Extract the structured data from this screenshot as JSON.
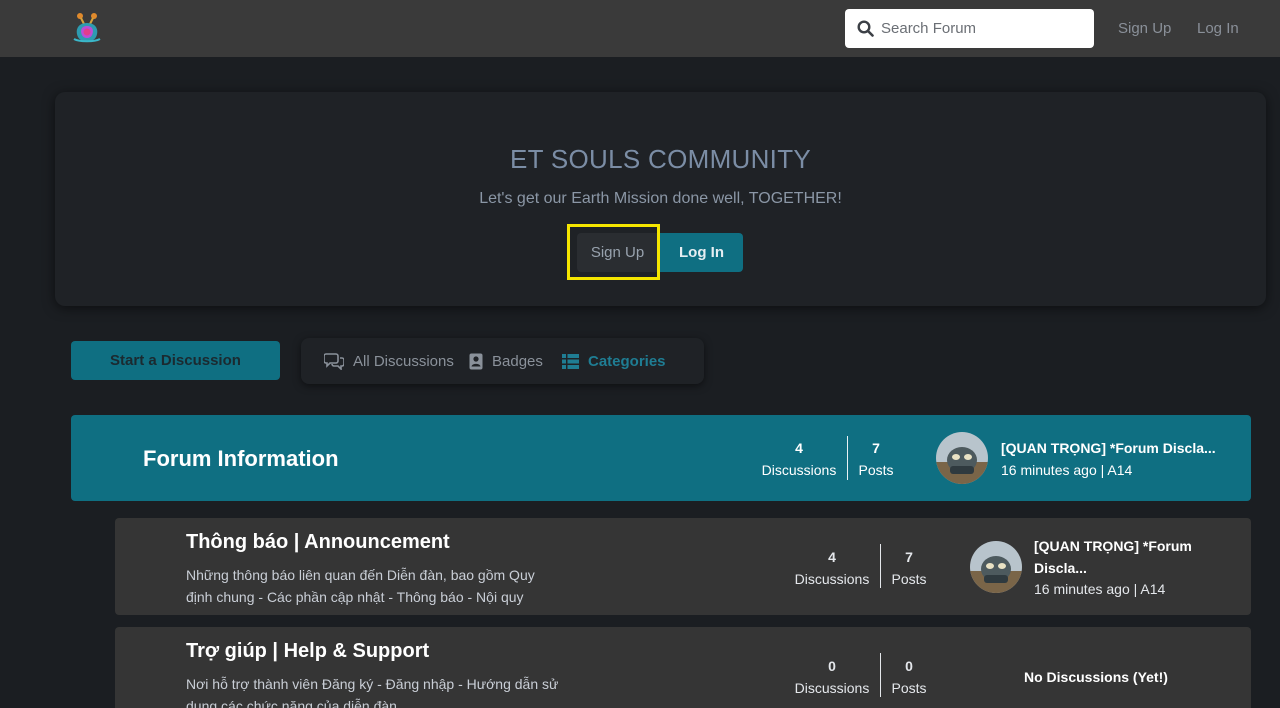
{
  "header": {
    "search_placeholder": "Search Forum",
    "signup": "Sign Up",
    "login": "Log In"
  },
  "hero": {
    "title": "ET SOULS COMMUNITY",
    "subtitle": "Let's get our Earth Mission done well, TOGETHER!",
    "signup": "Sign Up",
    "login": "Log In"
  },
  "toolbar": {
    "start": "Start a Discussion",
    "nav": [
      {
        "label": "All Discussions",
        "icon": "chat-bubbles-icon"
      },
      {
        "label": "Badges",
        "icon": "badge-icon"
      },
      {
        "label": "Categories",
        "icon": "grid-list-icon",
        "active": true
      }
    ]
  },
  "categories": {
    "main": {
      "title": "Forum Information",
      "discussions": "4",
      "discussions_label": "Discussions",
      "posts": "7",
      "posts_label": "Posts",
      "last_title": "[QUAN TRỌNG] *Forum Discla...",
      "last_meta": "16 minutes ago | A14"
    },
    "subs": [
      {
        "title": "Thông báo | Announcement",
        "desc": "Những thông báo liên quan đến Diễn đàn, bao gồm Quy định chung - Các phần cập nhật - Thông báo - Nội quy",
        "discussions": "4",
        "discussions_label": "Discussions",
        "posts": "7",
        "posts_label": "Posts",
        "last_title_1": "[QUAN TRỌNG] *Forum",
        "last_title_2": "Discla...",
        "last_meta": "16 minutes ago | A14"
      },
      {
        "title": "Trợ giúp | Help & Support",
        "desc": "Nơi hỗ trợ thành viên Đăng ký - Đăng nhập - Hướng dẫn sử dụng các chức năng của diễn đàn",
        "discussions": "0",
        "discussions_label": "Discussions",
        "posts": "0",
        "posts_label": "Posts",
        "empty": "No Discussions (Yet!)"
      }
    ]
  },
  "colors": {
    "accent": "#0f6f82",
    "background": "#1b1e22",
    "highlight": "#f5e600"
  }
}
